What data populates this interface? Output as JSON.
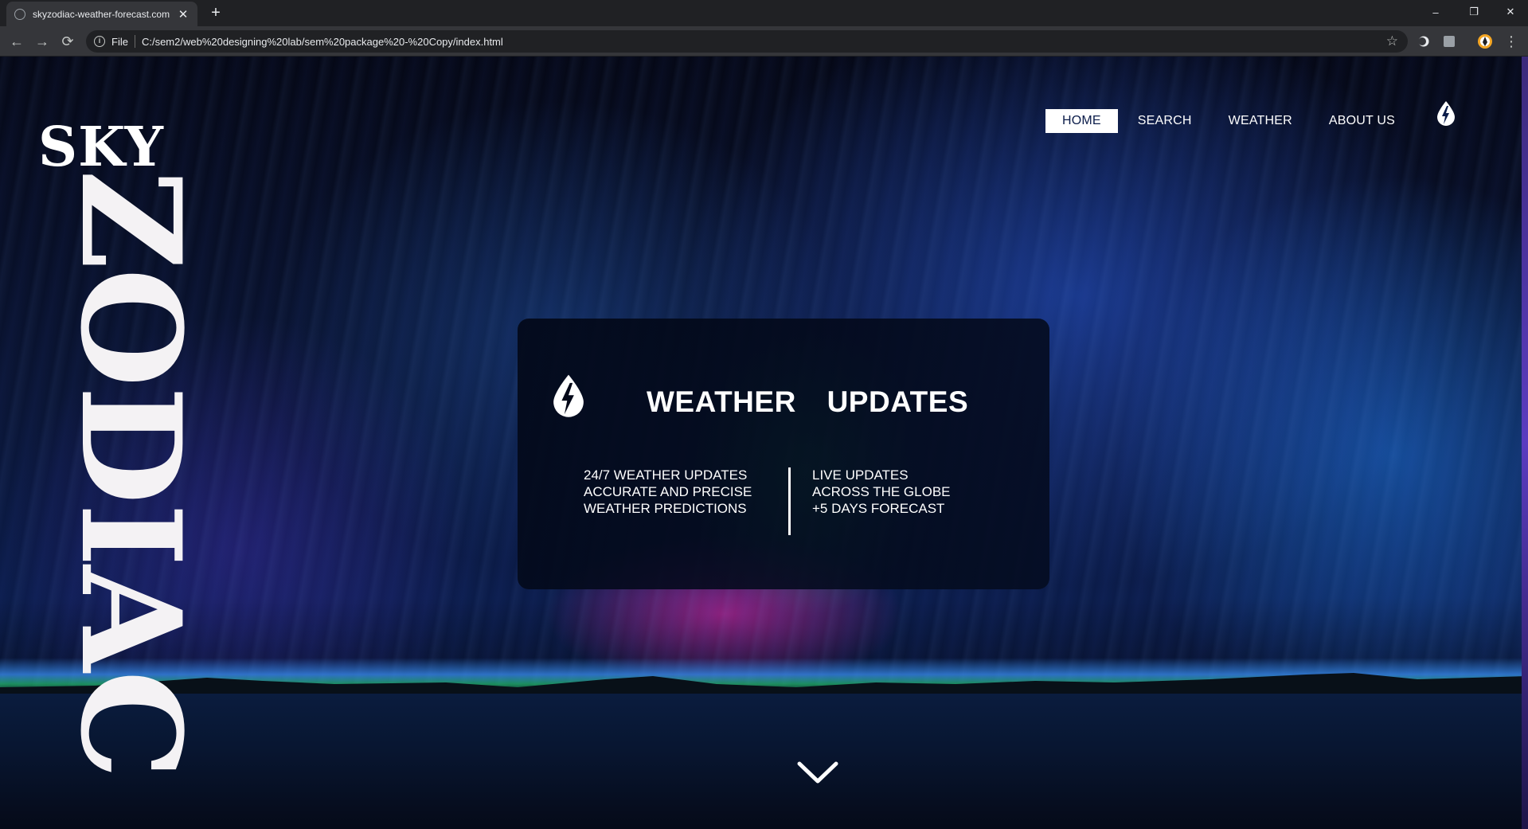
{
  "browser": {
    "tab_title": "skyzodiac-weather-forecast.com",
    "tab_close": "✕",
    "new_tab": "+",
    "scheme_label": "File",
    "url": "C:/sem2/web%20designing%20lab/sem%20package%20-%20Copy/index.html",
    "back_icon": "←",
    "forward_icon": "→",
    "reload_icon": "⟳",
    "star_icon": "☆",
    "minimize_icon": "–",
    "restore_icon": "❐",
    "close_icon": "✕",
    "menu_icon": "⋮"
  },
  "brand": {
    "line1": "SKY",
    "line2": "ZODIAC"
  },
  "nav": {
    "items": [
      {
        "label": "HOME",
        "active": true
      },
      {
        "label": "SEARCH",
        "active": false
      },
      {
        "label": "WEATHER",
        "active": false
      },
      {
        "label": "ABOUT US",
        "active": false
      }
    ]
  },
  "card": {
    "title": "WEATHER UPDATES",
    "left_lines": [
      "24/7 WEATHER UPDATES",
      "ACCURATE AND PRECISE",
      "WEATHER PREDICTIONS"
    ],
    "right_lines": [
      "LIVE UPDATES",
      "ACROSS THE GLOBE",
      "+5 DAYS FORECAST"
    ]
  },
  "colors": {
    "chrome_dark": "#202124",
    "chrome_toolbar": "#35363a",
    "nav_active_bg": "#ffffff",
    "nav_active_text": "#0b1c4a",
    "card_bg": "#030818"
  },
  "icons": {
    "drop_logo": "lightning-drop-icon",
    "scroll_down": "chevron-down-icon"
  }
}
